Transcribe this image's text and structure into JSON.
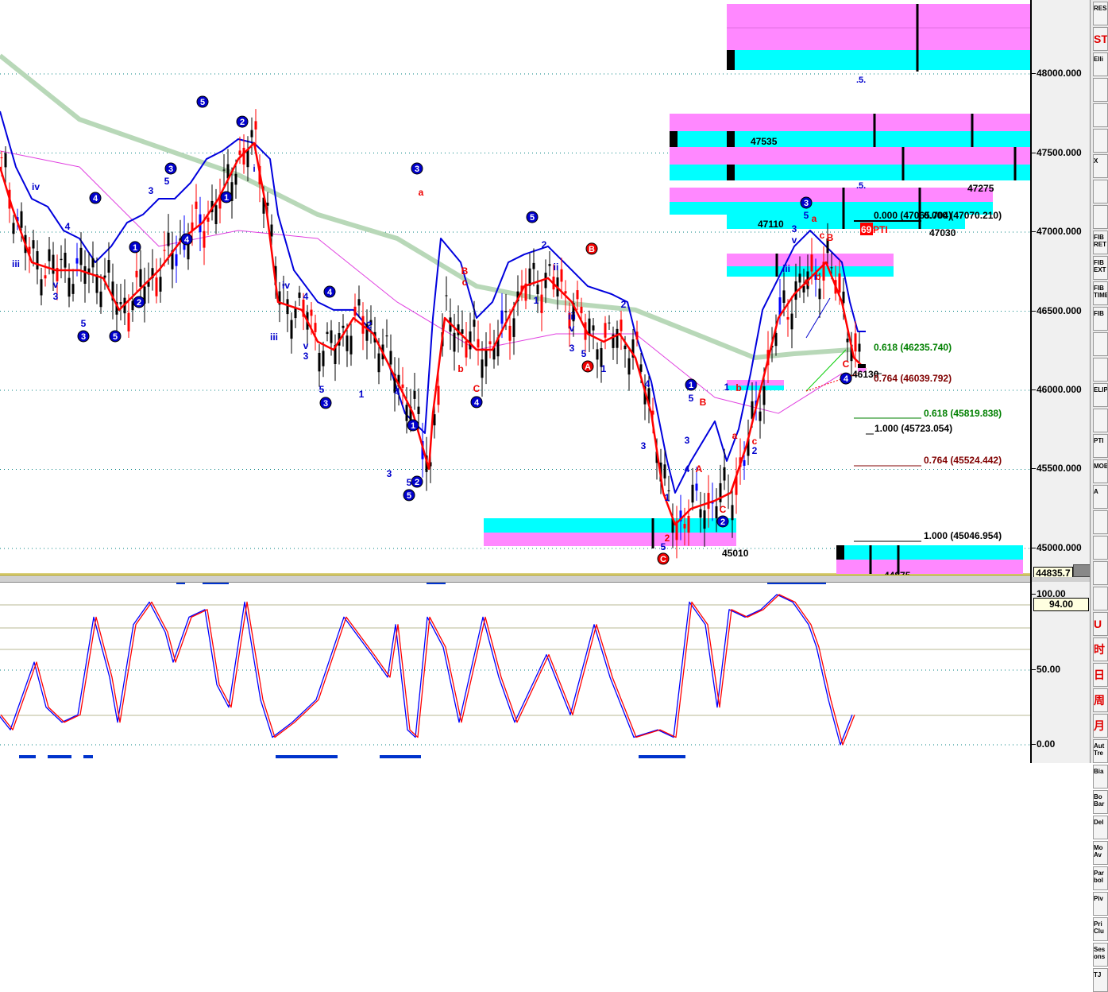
{
  "chart_data": {
    "type": "line",
    "title": "Elliott wave price chart with stochastic oscillator",
    "price_axis": {
      "ticks": [
        "48000.000",
        "47500.000",
        "47000.000",
        "46500.000",
        "46000.000",
        "45500.000",
        "45000.000"
      ],
      "range": [
        44835,
        48450
      ]
    },
    "osc_axis": {
      "ticks": [
        "100.00",
        "50.00",
        "0.00"
      ],
      "range": [
        0,
        100
      ]
    },
    "current_price_tag": "44835.7",
    "osc_tag": "94.00",
    "colors": {
      "fast": "#ff0000",
      "slow": "#0000dd",
      "ma_long": "#b8d8b8",
      "ma_mid": "#e040e0",
      "zone_a": "#ff88ff",
      "zone_b": "#00ffff",
      "grid": "#008080"
    },
    "series_fast": [
      [
        0,
        47412
      ],
      [
        3,
        47161
      ],
      [
        8,
        46809
      ],
      [
        14,
        46759
      ],
      [
        20,
        46759
      ],
      [
        26,
        46709
      ],
      [
        30,
        46508
      ],
      [
        35,
        46633
      ],
      [
        40,
        46759
      ],
      [
        46,
        46960
      ],
      [
        51,
        47060
      ],
      [
        55,
        47211
      ],
      [
        60,
        47462
      ],
      [
        64,
        47563
      ],
      [
        67,
        47161
      ],
      [
        70,
        46558
      ],
      [
        76,
        46508
      ],
      [
        80,
        46307
      ],
      [
        84,
        46256
      ],
      [
        89,
        46457
      ],
      [
        94,
        46357
      ],
      [
        99,
        46106
      ],
      [
        104,
        45854
      ],
      [
        108,
        45503
      ],
      [
        109,
        45854
      ],
      [
        112,
        46457
      ],
      [
        116,
        46357
      ],
      [
        120,
        46256
      ],
      [
        124,
        46256
      ],
      [
        128,
        46457
      ],
      [
        132,
        46658
      ],
      [
        138,
        46709
      ],
      [
        144,
        46558
      ],
      [
        148,
        46357
      ],
      [
        152,
        46307
      ],
      [
        156,
        46357
      ],
      [
        160,
        46206
      ],
      [
        164,
        45854
      ],
      [
        167,
        45352
      ],
      [
        170,
        45151
      ],
      [
        174,
        45251
      ],
      [
        180,
        45302
      ],
      [
        184,
        45352
      ],
      [
        188,
        45653
      ],
      [
        192,
        46055
      ],
      [
        196,
        46457
      ],
      [
        200,
        46608
      ],
      [
        204,
        46709
      ],
      [
        208,
        46809
      ],
      [
        212,
        46558
      ],
      [
        215,
        46206
      ],
      [
        218,
        46131
      ]
    ],
    "series_slow": [
      [
        0,
        47764
      ],
      [
        4,
        47412
      ],
      [
        8,
        47211
      ],
      [
        12,
        47161
      ],
      [
        16,
        47010
      ],
      [
        20,
        46960
      ],
      [
        24,
        46809
      ],
      [
        28,
        46910
      ],
      [
        32,
        47060
      ],
      [
        36,
        47111
      ],
      [
        40,
        47211
      ],
      [
        44,
        47211
      ],
      [
        48,
        47312
      ],
      [
        52,
        47462
      ],
      [
        56,
        47513
      ],
      [
        60,
        47588
      ],
      [
        64,
        47563
      ],
      [
        68,
        47462
      ],
      [
        70,
        47111
      ],
      [
        74,
        46759
      ],
      [
        80,
        46558
      ],
      [
        84,
        46508
      ],
      [
        89,
        46508
      ],
      [
        94,
        46357
      ],
      [
        98,
        46156
      ],
      [
        102,
        45854
      ],
      [
        107,
        45729
      ],
      [
        109,
        46457
      ],
      [
        111,
        46960
      ],
      [
        116,
        46809
      ],
      [
        120,
        46457
      ],
      [
        124,
        46558
      ],
      [
        128,
        46809
      ],
      [
        132,
        46859
      ],
      [
        138,
        46910
      ],
      [
        144,
        46759
      ],
      [
        148,
        46658
      ],
      [
        154,
        46608
      ],
      [
        158,
        46558
      ],
      [
        160,
        46357
      ],
      [
        164,
        46055
      ],
      [
        168,
        45553
      ],
      [
        170,
        45352
      ],
      [
        174,
        45553
      ],
      [
        180,
        45804
      ],
      [
        183,
        45553
      ],
      [
        186,
        45754
      ],
      [
        189,
        46106
      ],
      [
        192,
        46508
      ],
      [
        196,
        46709
      ],
      [
        200,
        46910
      ],
      [
        204,
        47010
      ],
      [
        208,
        46910
      ],
      [
        212,
        46809
      ],
      [
        214,
        46558
      ],
      [
        216,
        46372
      ],
      [
        218,
        46372
      ]
    ],
    "series_ma_long": [
      [
        0,
        48116
      ],
      [
        20,
        47713
      ],
      [
        60,
        47362
      ],
      [
        80,
        47111
      ],
      [
        100,
        46960
      ],
      [
        120,
        46658
      ],
      [
        140,
        46558
      ],
      [
        160,
        46508
      ],
      [
        180,
        46307
      ],
      [
        190,
        46206
      ],
      [
        200,
        46231
      ],
      [
        214,
        46256
      ]
    ],
    "series_ma_mid": [
      [
        0,
        47513
      ],
      [
        20,
        47412
      ],
      [
        40,
        46910
      ],
      [
        60,
        47010
      ],
      [
        80,
        46960
      ],
      [
        100,
        46558
      ],
      [
        120,
        46256
      ],
      [
        140,
        46357
      ],
      [
        160,
        46357
      ],
      [
        180,
        45955
      ],
      [
        196,
        45854
      ],
      [
        212,
        46106
      ]
    ],
    "oscillator": [
      [
        0,
        20
      ],
      [
        3,
        10
      ],
      [
        9,
        55
      ],
      [
        12,
        25
      ],
      [
        16,
        15
      ],
      [
        20,
        20
      ],
      [
        24,
        85
      ],
      [
        28,
        45
      ],
      [
        30,
        15
      ],
      [
        34,
        80
      ],
      [
        38,
        95
      ],
      [
        42,
        75
      ],
      [
        44,
        55
      ],
      [
        48,
        85
      ],
      [
        52,
        90
      ],
      [
        55,
        40
      ],
      [
        58,
        25
      ],
      [
        62,
        95
      ],
      [
        66,
        30
      ],
      [
        69,
        5
      ],
      [
        74,
        15
      ],
      [
        80,
        30
      ],
      [
        87,
        85
      ],
      [
        94,
        60
      ],
      [
        98,
        45
      ],
      [
        100,
        80
      ],
      [
        103,
        10
      ],
      [
        105,
        5
      ],
      [
        108,
        85
      ],
      [
        112,
        65
      ],
      [
        116,
        15
      ],
      [
        122,
        85
      ],
      [
        126,
        45
      ],
      [
        130,
        15
      ],
      [
        138,
        60
      ],
      [
        144,
        20
      ],
      [
        150,
        80
      ],
      [
        154,
        45
      ],
      [
        160,
        5
      ],
      [
        166,
        10
      ],
      [
        170,
        5
      ],
      [
        174,
        95
      ],
      [
        178,
        80
      ],
      [
        181,
        25
      ],
      [
        184,
        90
      ],
      [
        188,
        85
      ],
      [
        192,
        90
      ],
      [
        196,
        100
      ],
      [
        200,
        95
      ],
      [
        204,
        80
      ],
      [
        206,
        65
      ],
      [
        209,
        30
      ],
      [
        212,
        0
      ],
      [
        215,
        20
      ]
    ],
    "wave_labels": [
      {
        "t": "5",
        "b": 51,
        "p": 47824,
        "s": "cb"
      },
      {
        "t": "2",
        "b": 61,
        "p": 47698,
        "s": "cb"
      },
      {
        "t": "1",
        "b": 57,
        "p": 47221,
        "s": "cb"
      },
      {
        "t": "3",
        "b": 43,
        "p": 47402,
        "s": "cb"
      },
      {
        "t": "4",
        "b": 24,
        "p": 47216,
        "s": "cb"
      },
      {
        "t": "1",
        "b": 34,
        "p": 46905,
        "s": "cb"
      },
      {
        "t": "2",
        "b": 35,
        "p": 46558,
        "s": "cb"
      },
      {
        "t": "4",
        "b": 47,
        "p": 46955,
        "s": "cb"
      },
      {
        "t": "3",
        "b": 21,
        "p": 46342,
        "s": "cb"
      },
      {
        "t": "5",
        "b": 29,
        "p": 46342,
        "s": "cb"
      },
      {
        "t": "3",
        "b": 105,
        "p": 47402,
        "s": "cb"
      },
      {
        "t": "5",
        "b": 134,
        "p": 47095,
        "s": "cb"
      },
      {
        "t": "4",
        "b": 83,
        "p": 46623,
        "s": "cb"
      },
      {
        "t": "3",
        "b": 82,
        "p": 45920,
        "s": "cb"
      },
      {
        "t": "1",
        "b": 104,
        "p": 45779,
        "s": "cb"
      },
      {
        "t": "2",
        "b": 105,
        "p": 45422,
        "s": "cb"
      },
      {
        "t": "5",
        "b": 103,
        "p": 45337,
        "s": "cb"
      },
      {
        "t": "4",
        "b": 120,
        "p": 45925,
        "s": "cb"
      },
      {
        "t": "1",
        "b": 174,
        "p": 46035,
        "s": "cb"
      },
      {
        "t": "2",
        "b": 182,
        "p": 45171,
        "s": "cb"
      },
      {
        "t": "3",
        "b": 203,
        "p": 47186,
        "s": "cb"
      },
      {
        "t": "4",
        "b": 213,
        "p": 46075,
        "s": "cb"
      },
      {
        "t": "B",
        "b": 149,
        "p": 46895,
        "s": "cr"
      },
      {
        "t": "A",
        "b": 148,
        "p": 46151,
        "s": "cr"
      },
      {
        "t": "C",
        "b": 167,
        "p": 44935,
        "s": "cr"
      },
      {
        "t": "iv",
        "b": 9,
        "p": 47286,
        "s": "b"
      },
      {
        "t": "iii",
        "b": 4,
        "p": 46799,
        "s": "b"
      },
      {
        "t": "v",
        "b": 14,
        "p": 46668,
        "s": "b"
      },
      {
        "t": "3",
        "b": 14,
        "p": 46593,
        "s": "b"
      },
      {
        "t": "4",
        "b": 17,
        "p": 47035,
        "s": "b"
      },
      {
        "t": "5",
        "b": 21,
        "p": 46422,
        "s": "b"
      },
      {
        "t": "3",
        "b": 38,
        "p": 47261,
        "s": "b"
      },
      {
        "t": "5",
        "b": 42,
        "p": 47322,
        "s": "b"
      },
      {
        "t": "i",
        "b": 64,
        "p": 47402,
        "s": "b"
      },
      {
        "t": "iv",
        "b": 72,
        "p": 46663,
        "s": "b"
      },
      {
        "t": "iii",
        "b": 69,
        "p": 46337,
        "s": "b"
      },
      {
        "t": "v",
        "b": 77,
        "p": 46281,
        "s": "b"
      },
      {
        "t": "3",
        "b": 77,
        "p": 46216,
        "s": "b"
      },
      {
        "t": "5",
        "b": 81,
        "p": 46005,
        "s": "b"
      },
      {
        "t": "4",
        "b": 77,
        "p": 46593,
        "s": "b"
      },
      {
        "t": "2",
        "b": 93,
        "p": 46412,
        "s": "b"
      },
      {
        "t": "1",
        "b": 91,
        "p": 45975,
        "s": "b"
      },
      {
        "t": "4",
        "b": 100,
        "p": 45990,
        "s": "b"
      },
      {
        "t": "3",
        "b": 98,
        "p": 45472,
        "s": "b"
      },
      {
        "t": "5",
        "b": 103,
        "p": 45417,
        "s": "b"
      },
      {
        "t": "2",
        "b": 137,
        "p": 46920,
        "s": "b"
      },
      {
        "t": "1",
        "b": 135,
        "p": 46568,
        "s": "b"
      },
      {
        "t": "ii",
        "b": 140,
        "p": 46779,
        "s": "b"
      },
      {
        "t": "iii",
        "b": 144,
        "p": 46467,
        "s": "b"
      },
      {
        "t": "v",
        "b": 144,
        "p": 46392,
        "s": "b"
      },
      {
        "t": "3",
        "b": 144,
        "p": 46266,
        "s": "b"
      },
      {
        "t": "5",
        "b": 147,
        "p": 46231,
        "s": "b"
      },
      {
        "t": "1",
        "b": 152,
        "p": 46136,
        "s": "b"
      },
      {
        "t": "2",
        "b": 157,
        "p": 46543,
        "s": "b"
      },
      {
        "t": "4",
        "b": 163,
        "p": 46040,
        "s": "b"
      },
      {
        "t": "3",
        "b": 162,
        "p": 45648,
        "s": "b"
      },
      {
        "t": "5",
        "b": 174,
        "p": 45950,
        "s": "b"
      },
      {
        "t": "4",
        "b": 173,
        "p": 45503,
        "s": "b"
      },
      {
        "t": "3",
        "b": 173,
        "p": 45683,
        "s": "b"
      },
      {
        "t": "1",
        "b": 168,
        "p": 45322,
        "s": "b"
      },
      {
        "t": "5",
        "b": 167,
        "p": 45010,
        "s": "b"
      },
      {
        "t": "1",
        "b": 183,
        "p": 46020,
        "s": "b"
      },
      {
        "t": "2",
        "b": 190,
        "p": 45618,
        "s": "b"
      },
      {
        "t": "iii",
        "b": 198,
        "p": 46769,
        "s": "b"
      },
      {
        "t": "3",
        "b": 200,
        "p": 47020,
        "s": "b"
      },
      {
        "t": "v",
        "b": 200,
        "p": 46950,
        "s": "b"
      },
      {
        "t": "5",
        "b": 203,
        "p": 47106,
        "s": "b"
      },
      {
        "t": "a",
        "b": 106,
        "p": 47251,
        "s": "r"
      },
      {
        "t": "B",
        "b": 117,
        "p": 46754,
        "s": "r"
      },
      {
        "t": "c",
        "b": 117,
        "p": 46683,
        "s": "r"
      },
      {
        "t": "b",
        "b": 116,
        "p": 46136,
        "s": "r"
      },
      {
        "t": "C",
        "b": 120,
        "p": 46010,
        "s": "r"
      },
      {
        "t": "B",
        "b": 177,
        "p": 45925,
        "s": "r"
      },
      {
        "t": "A",
        "b": 176,
        "p": 45503,
        "s": "r"
      },
      {
        "t": "C",
        "b": 182,
        "p": 45246,
        "s": "r"
      },
      {
        "t": "a",
        "b": 185,
        "p": 45714,
        "s": "r"
      },
      {
        "t": "b",
        "b": 186,
        "p": 46015,
        "s": "r"
      },
      {
        "t": "c",
        "b": 190,
        "p": 45678,
        "s": "r"
      },
      {
        "t": "a",
        "b": 205,
        "p": 47085,
        "s": "r"
      },
      {
        "t": "B",
        "b": 209,
        "p": 46965,
        "s": "r"
      },
      {
        "t": "c",
        "b": 207,
        "p": 46980,
        "s": "r"
      },
      {
        "t": "A",
        "b": 203,
        "p": 46678,
        "s": "r"
      },
      {
        "t": "b",
        "b": 206,
        "p": 46719,
        "s": "r"
      },
      {
        "t": "C",
        "b": 213,
        "p": 46166,
        "s": "r"
      },
      {
        "t": "2",
        "b": 168,
        "p": 45065,
        "s": "r"
      }
    ]
  },
  "annotations": {
    "zone_prices": [
      "47535",
      "47275",
      "47110",
      "47030",
      "45010",
      "46130",
      "44875"
    ],
    "fib_levels": [
      {
        "label": "0.000 (47065.704)",
        "color": "#000000"
      },
      {
        "label": "0.000 (47070.210)",
        "color": "#000000"
      },
      {
        "label": "0.618 (46235.740)",
        "color": "#008000"
      },
      {
        "label": "0.764 (46039.792)",
        "color": "#800000"
      },
      {
        "label": "0.618 (45819.838)",
        "color": "#008000"
      },
      {
        "label": "1.000 (45723.054)",
        "color": "#000000"
      },
      {
        "label": "0.764 (45524.442)",
        "color": "#800000"
      },
      {
        "label": "1.000 (45046.954)",
        "color": "#000000"
      }
    ],
    "pti_count": "69",
    "pti_label": "PTI",
    "target_marks": [
      ".5.",
      ".5."
    ]
  },
  "toolbar": [
    "RES",
    "STU",
    "Elli",
    "",
    "",
    "",
    "X",
    "",
    "",
    "FIB\nRET",
    "FIB\nEXT",
    "FIB\nTIME",
    "FIB",
    "",
    "",
    "ELIPS",
    "",
    "PTI",
    "MOB",
    "A",
    "",
    "",
    "",
    "",
    "U",
    "时",
    "日",
    "周",
    "月",
    "Aut\nTre",
    "Bia",
    "Bo\nBar",
    "Del",
    "Mo\nAv",
    "Par\nbol",
    "Piv",
    "Pri\nClu",
    "Ses\nons",
    "TJ"
  ]
}
